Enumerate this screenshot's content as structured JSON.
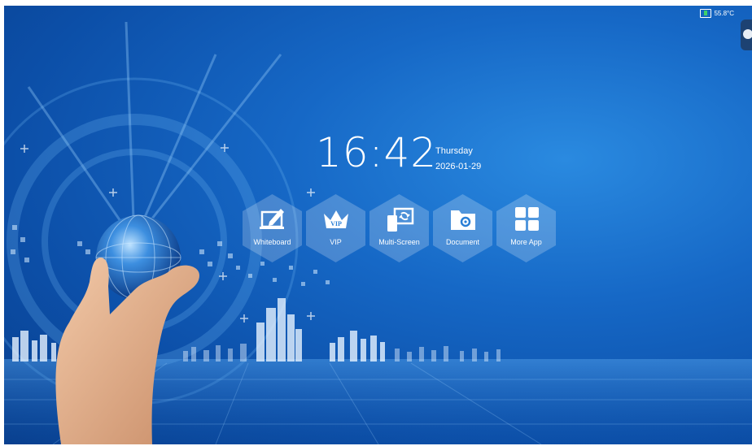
{
  "status_bar": {
    "temperature": "55.8°C"
  },
  "clock": {
    "time": "16:42",
    "weekday": "Thursday",
    "date": "2026-01-29"
  },
  "apps": [
    {
      "label": "Whiteboard",
      "icon": "whiteboard-pen-icon"
    },
    {
      "label": "VIP",
      "icon": "vip-crown-icon"
    },
    {
      "label": "Multi-Screen",
      "icon": "screen-share-icon"
    },
    {
      "label": "Document",
      "icon": "folder-gear-icon"
    },
    {
      "label": "More App",
      "icon": "app-grid-icon"
    }
  ],
  "colors": {
    "background": "#1668c6",
    "text": "#ffffff",
    "tile": "rgba(255,255,255,0.22)"
  }
}
